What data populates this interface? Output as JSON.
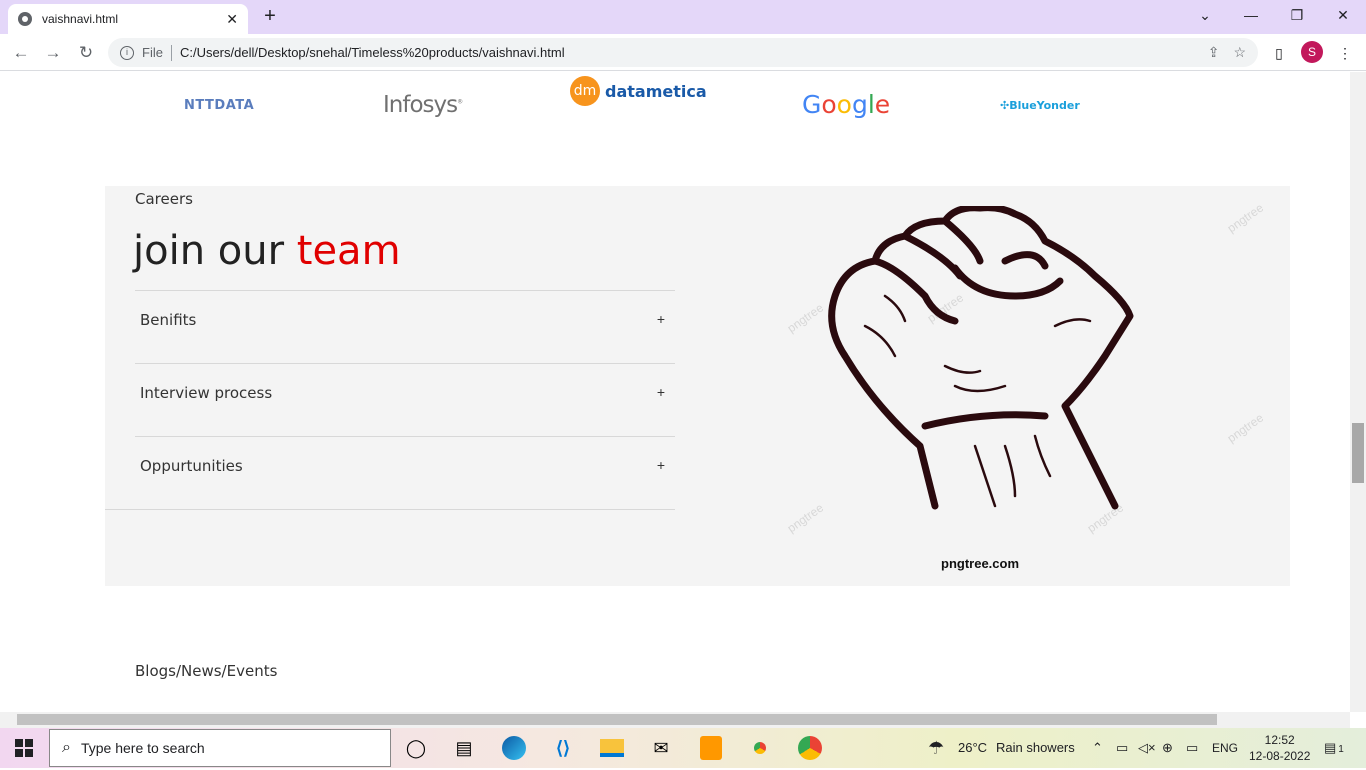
{
  "browser": {
    "tab_title": "vaishnavi.html",
    "close_glyph": "✕",
    "new_tab_glyph": "+",
    "scheme": "File",
    "url": "C:/Users/dell/Desktop/snehal/Timeless%20products/vaishnavi.html",
    "profile_initial": "S",
    "profile_color": "#c2185b"
  },
  "logos": {
    "ntt": "NTTDATA",
    "infosys": "Infosys",
    "infosys_tm": "®",
    "datametica_mark": "dm",
    "datametica": "datametica",
    "google": [
      "G",
      "o",
      "o",
      "g",
      "l",
      "e"
    ],
    "blueyonder": "BlueYonder"
  },
  "careers": {
    "eyebrow": "Careers",
    "heading_plain": "join our",
    "heading_accent": "team",
    "accent_color": "#e00000",
    "items": [
      {
        "label": "Benifits",
        "icon": "+"
      },
      {
        "label": "Interview process",
        "icon": "+"
      },
      {
        "label": "Oppurtunities",
        "icon": "+"
      }
    ],
    "image_credit": "pngtree.com",
    "watermark": "pngtree"
  },
  "blogs": {
    "eyebrow": "Blogs/News/Events"
  },
  "taskbar": {
    "search_placeholder": "Type here to search",
    "weather_temp": "26°C",
    "weather_text": "Rain showers",
    "language": "ENG",
    "time": "12:52",
    "date": "12-08-2022",
    "notification_count": "1",
    "apps": [
      "task-view-icon",
      "widgets-icon",
      "edge-icon",
      "vscode-icon",
      "file-explorer-icon",
      "mail-icon",
      "sublime-icon",
      "chrome-icon",
      "chrome-profile-icon"
    ]
  }
}
